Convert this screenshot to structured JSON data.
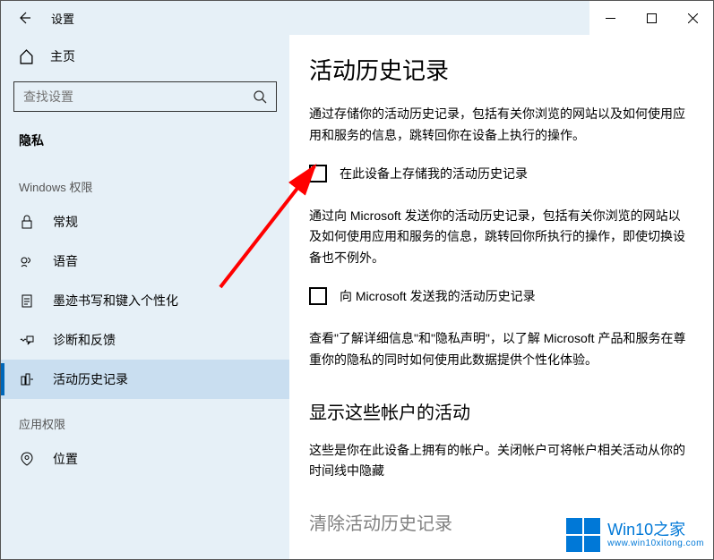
{
  "titlebar": {
    "title": "设置"
  },
  "sidebar": {
    "home": "主页",
    "search_placeholder": "查找设置",
    "section": "隐私",
    "group_windows": "Windows 权限",
    "items": {
      "general": "常规",
      "speech": "语音",
      "ink": "墨迹书写和键入个性化",
      "diag": "诊断和反馈",
      "activity": "活动历史记录"
    },
    "group_app": "应用权限",
    "items2": {
      "location": "位置"
    }
  },
  "content": {
    "heading": "活动历史记录",
    "para1": "通过存储你的活动历史记录，包括有关你浏览的网站以及如何使用应用和服务的信息，跳转回你在设备上执行的操作。",
    "checkbox1": "在此设备上存储我的活动历史记录",
    "para2": "通过向 Microsoft 发送你的活动历史记录，包括有关你浏览的网站以及如何使用应用和服务的信息，跳转回你所执行的操作，即使切换设备也不例外。",
    "checkbox2": "向 Microsoft 发送我的活动历史记录",
    "para3": "查看\"了解详细信息\"和\"隐私声明\"，以了解 Microsoft 产品和服务在尊重你的隐私的同时如何使用此数据提供个性化体验。",
    "heading2": "显示这些帐户的活动",
    "para4": "这些是你在此设备上拥有的帐户。关闭帐户可将帐户相关活动从你的时间线中隐藏",
    "heading3_partial": "清除活动历史记录"
  },
  "watermark": {
    "brand": "Win10之家",
    "url": "www.win10xitong.com"
  }
}
